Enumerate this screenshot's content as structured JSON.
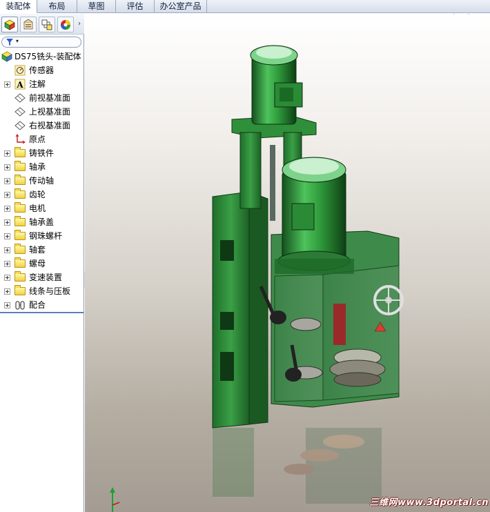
{
  "command_tabs": [
    {
      "label": "装配体",
      "active": true
    },
    {
      "label": "布局",
      "active": false
    },
    {
      "label": "草图",
      "active": false
    },
    {
      "label": "评估",
      "active": false
    },
    {
      "label": "办公室产品",
      "active": false
    }
  ],
  "panel_tabs": [
    {
      "icon": "feature-manager-icon",
      "active": true
    },
    {
      "icon": "property-manager-icon",
      "active": false
    },
    {
      "icon": "configuration-manager-icon",
      "active": false
    },
    {
      "icon": "display-manager-icon",
      "active": false
    }
  ],
  "panel_more_glyph": "›",
  "filter": {
    "icon": "filter-icon",
    "caret": "▾"
  },
  "tree": {
    "root": {
      "label": "DS75铣头-装配体",
      "icon": "assembly-icon"
    },
    "items": [
      {
        "label": "传感器",
        "icon": "sensor-icon",
        "expandable": false
      },
      {
        "label": "注解",
        "icon": "annotation-icon",
        "expandable": true
      },
      {
        "label": "前视基准面",
        "icon": "plane-icon",
        "expandable": false
      },
      {
        "label": "上视基准面",
        "icon": "plane-icon",
        "expandable": false
      },
      {
        "label": "右视基准面",
        "icon": "plane-icon",
        "expandable": false
      },
      {
        "label": "原点",
        "icon": "origin-icon",
        "expandable": false
      },
      {
        "label": "铸铁件",
        "icon": "folder-icon",
        "expandable": true
      },
      {
        "label": "轴承",
        "icon": "folder-icon",
        "expandable": true
      },
      {
        "label": "传动轴",
        "icon": "folder-icon",
        "expandable": true
      },
      {
        "label": "齿轮",
        "icon": "folder-icon",
        "expandable": true
      },
      {
        "label": "电机",
        "icon": "folder-icon",
        "expandable": true
      },
      {
        "label": "轴承盖",
        "icon": "folder-icon",
        "expandable": true
      },
      {
        "label": "钢珠螺杆",
        "icon": "folder-icon",
        "expandable": true
      },
      {
        "label": "轴套",
        "icon": "folder-icon",
        "expandable": true
      },
      {
        "label": "螺母",
        "icon": "folder-icon",
        "expandable": true
      },
      {
        "label": "变速装置",
        "icon": "folder-icon",
        "expandable": true
      },
      {
        "label": "线条与压板",
        "icon": "folder-icon",
        "expandable": true
      },
      {
        "label": "配合",
        "icon": "mates-icon",
        "expandable": true
      }
    ]
  },
  "view_tools": [
    "zoom-to-fit-icon",
    "zoom-area-icon",
    "previous-view-icon"
  ],
  "watermark": "三维网www.3dportal.cn",
  "colors": {
    "model_green": "#2e8b3a",
    "tab_bar": "#d5dde9",
    "selection_blue": "#5a7fb8"
  }
}
